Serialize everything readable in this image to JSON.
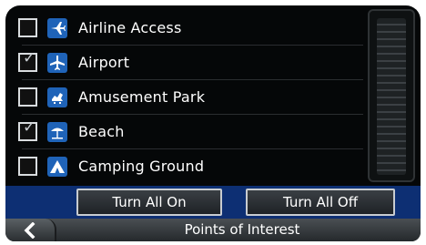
{
  "poi_list": [
    {
      "label": "Airline Access",
      "checked": false,
      "icon": "airline-access-icon"
    },
    {
      "label": "Airport",
      "checked": true,
      "icon": "airport-icon"
    },
    {
      "label": "Amusement Park",
      "checked": false,
      "icon": "amusement-park-icon"
    },
    {
      "label": "Beach",
      "checked": true,
      "icon": "beach-icon"
    },
    {
      "label": "Camping Ground",
      "checked": false,
      "icon": "camping-ground-icon"
    }
  ],
  "buttons": {
    "turn_all_on": "Turn All On",
    "turn_all_off": "Turn All Off"
  },
  "footer": {
    "title": "Points of Interest",
    "back_icon": "chevron-left-icon"
  },
  "colors": {
    "screen_bg": "#050708",
    "icon_bg": "#1f63b8",
    "button_bar_bg": "#0d2f73",
    "text": "#ffffff"
  }
}
